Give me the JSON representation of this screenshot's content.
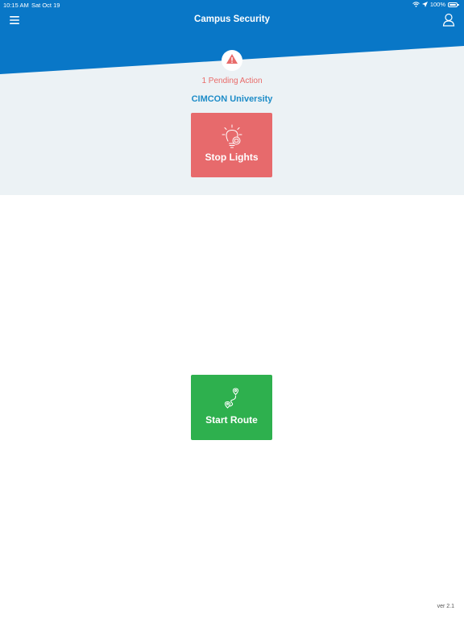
{
  "status_bar": {
    "time": "10:15 AM",
    "date": "Sat Oct 19",
    "battery": "100%",
    "icons": [
      "wifi-icon",
      "location-icon",
      "battery-icon"
    ]
  },
  "header": {
    "title": "Campus Security",
    "menu_icon": "hamburger-menu-icon",
    "profile_icon": "user-profile-icon"
  },
  "alert": {
    "icon": "warning-triangle-icon",
    "pending_text": "1 Pending Action"
  },
  "organization": "CIMCON University",
  "actions": {
    "stop_lights": {
      "label": "Stop Lights",
      "icon": "lightbulb-icon"
    },
    "start_route": {
      "label": "Start Route",
      "icon": "route-pin-icon"
    }
  },
  "footer": {
    "version": "ver 2.1"
  },
  "colors": {
    "header_blue": "#0977c7",
    "panel_bg": "#ecf2f5",
    "alert_red": "#e96b69",
    "org_blue": "#1d8cc8",
    "stop_tile": "#e76a6c",
    "start_tile": "#2eb04e"
  }
}
